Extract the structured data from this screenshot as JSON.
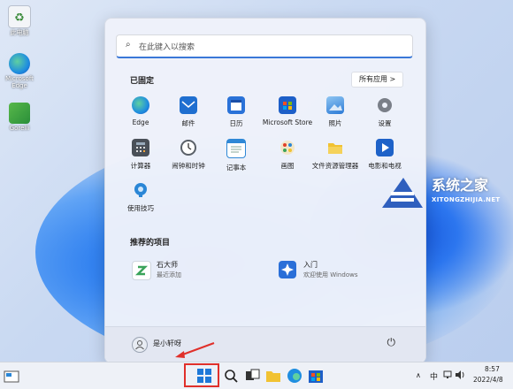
{
  "desktop": {
    "icons": [
      {
        "label": "此电脑",
        "icon": "recycle-bin-icon"
      },
      {
        "label": "Microsoft Edge",
        "icon": "edge-icon"
      },
      {
        "label": "Gorelli",
        "icon": "app-icon"
      }
    ]
  },
  "start_menu": {
    "search_placeholder": "在此键入以搜索",
    "pinned_title": "已固定",
    "all_apps_label": "所有应用  >",
    "pinned": [
      {
        "name": "Edge",
        "color": "#1f8ee0"
      },
      {
        "name": "邮件",
        "color": "#1f6fd0"
      },
      {
        "name": "日历",
        "color": "#2a72d8"
      },
      {
        "name": "Microsoft Store",
        "color": "#1d5fc8"
      },
      {
        "name": "照片",
        "color": "#2b7ad6"
      },
      {
        "name": "设置",
        "color": "#7a7f88"
      },
      {
        "name": "计算器",
        "color": "#4a5058"
      },
      {
        "name": "闹钟和时钟",
        "color": "#5a6068"
      },
      {
        "name": "记事本",
        "color": "#2f88d6"
      },
      {
        "name": "画图",
        "color": "#e89b2a"
      },
      {
        "name": "文件资源管理器",
        "color": "#f1c232"
      },
      {
        "name": "电影和电视",
        "color": "#1e62c8"
      },
      {
        "name": "使用技巧",
        "color": "#2a86d6"
      }
    ],
    "recommended_title": "推荐的项目",
    "recommended": [
      {
        "title": "石大师",
        "subtitle": "最近添加",
        "color": "#3aa35a"
      },
      {
        "title": "入门",
        "subtitle": "欢迎使用 Windows",
        "color": "#2a6fd8"
      }
    ],
    "user_name": "是小轩呀",
    "power_icon": "power-icon"
  },
  "watermark": {
    "title": "系统之家",
    "subtitle": "XITONGZHIJIA.NET"
  },
  "taskbar": {
    "ime": "中",
    "time": "8:57",
    "date": "2022/4/8"
  }
}
